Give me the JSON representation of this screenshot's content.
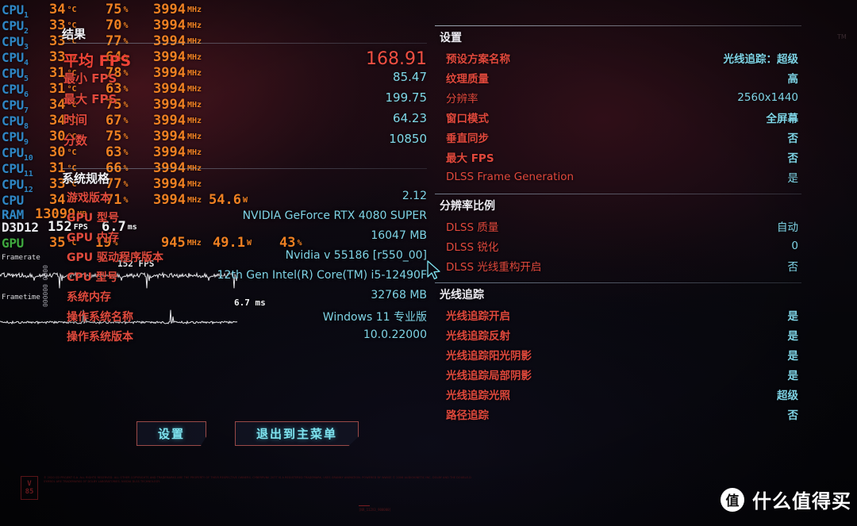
{
  "osd": {
    "units": {
      "temp": "°C",
      "pct": "%",
      "mhz": "MHz",
      "watt": "W",
      "mb": "MB",
      "fps": "FPS",
      "ms": "ms"
    },
    "rows": [
      {
        "name": "CPU",
        "sub": "1",
        "temp": "34",
        "use": "75",
        "clk": "3994"
      },
      {
        "name": "CPU",
        "sub": "2",
        "temp": "33",
        "use": "70",
        "clk": "3994"
      },
      {
        "name": "CPU",
        "sub": "3",
        "temp": "33",
        "use": "77",
        "clk": "3994"
      },
      {
        "name": "CPU",
        "sub": "4",
        "temp": "33",
        "use": "64",
        "clk": "3994"
      },
      {
        "name": "CPU",
        "sub": "5",
        "temp": "31",
        "use": "78",
        "clk": "3994"
      },
      {
        "name": "CPU",
        "sub": "6",
        "temp": "31",
        "use": "63",
        "clk": "3994"
      },
      {
        "name": "CPU",
        "sub": "7",
        "temp": "34",
        "use": "75",
        "clk": "3994"
      },
      {
        "name": "CPU",
        "sub": "8",
        "temp": "34",
        "use": "67",
        "clk": "3994"
      },
      {
        "name": "CPU",
        "sub": "9",
        "temp": "30",
        "use": "75",
        "clk": "3994"
      },
      {
        "name": "CPU",
        "sub": "10",
        "temp": "30",
        "use": "63",
        "clk": "3994"
      },
      {
        "name": "CPU",
        "sub": "11",
        "temp": "31",
        "use": "66",
        "clk": "3994"
      },
      {
        "name": "CPU",
        "sub": "12",
        "temp": "33",
        "use": "77",
        "clk": "3994"
      }
    ],
    "cpu_total": {
      "name": "CPU",
      "temp": "34",
      "use": "71",
      "clk": "3994",
      "power": "54.6"
    },
    "ram": {
      "name": "RAM",
      "value": "13099"
    },
    "d3d12": {
      "name": "D3D12",
      "fps": "152",
      "frametime": "6.7"
    },
    "gpu": {
      "name": "GPU",
      "temp": "35",
      "use": "19",
      "clk": "945",
      "power": "49.1",
      "mem": "43"
    },
    "framerate_label": "Framerate",
    "frametime_label": "Frametime",
    "framerate_side": "0000 000000",
    "graph_fps": "152 FPS",
    "graph_ms": "6.7 ms"
  },
  "benchmark": {
    "title": "结果",
    "rows": [
      {
        "label": "平均 FPS",
        "value": "168.91",
        "big": true
      },
      {
        "label": "最小 FPS",
        "value": "85.47",
        "big": false
      },
      {
        "label": "最大 FPS",
        "value": "199.75",
        "big": false
      },
      {
        "label": "时间",
        "value": "64.23",
        "big": false
      },
      {
        "label": "分数",
        "value": "10850",
        "big": false
      }
    ]
  },
  "spec": {
    "title": "系统规格",
    "rows": [
      {
        "label": "游戏版本",
        "value": "2.12"
      },
      {
        "label": "GPU 型号",
        "value": "NVIDIA GeForce RTX 4080 SUPER"
      },
      {
        "label": "GPU 内存",
        "value": "16047 MB"
      },
      {
        "label": "GPU 驱动程序版本",
        "value": "Nvidia v 55186 [r550_00]"
      },
      {
        "label": "CPU 型号",
        "value": "12th Gen Intel(R) Core(TM) i5-12490F"
      },
      {
        "label": "系统内存",
        "value": "32768 MB"
      },
      {
        "label": "操作系统名称",
        "value": "Windows 11 专业版"
      },
      {
        "label": "操作系统版本",
        "value": "10.0.22000"
      }
    ]
  },
  "settings": {
    "title": "设置",
    "rows": [
      {
        "label": "预设方案名称",
        "value": "光线追踪：超级",
        "latin": false
      },
      {
        "label": "纹理质量",
        "value": "高",
        "latin": false
      },
      {
        "label": "分辨率",
        "value": "2560x1440",
        "latin": true
      },
      {
        "label": "窗口模式",
        "value": "全屏幕",
        "latin": false
      },
      {
        "label": "垂直同步",
        "value": "否",
        "latin": false
      },
      {
        "label": "最大 FPS",
        "value": "否",
        "latin": false
      },
      {
        "label": "DLSS Frame Generation",
        "value": "是",
        "latin": true
      }
    ]
  },
  "resolution_scale": {
    "title": "分辨率比例",
    "rows": [
      {
        "label": "DLSS 质量",
        "value": "自动",
        "latin": true
      },
      {
        "label": "DLSS 锐化",
        "value": "0",
        "latin": true
      },
      {
        "label": "DLSS 光线重构开启",
        "value": "否",
        "latin": true
      }
    ]
  },
  "ray_tracing": {
    "title": "光线追踪",
    "rows": [
      {
        "label": "光线追踪开启",
        "value": "是",
        "latin": false
      },
      {
        "label": "光线追踪反射",
        "value": "是",
        "latin": false
      },
      {
        "label": "光线追踪阳光阴影",
        "value": "是",
        "latin": false
      },
      {
        "label": "光线追踪局部阴影",
        "value": "是",
        "latin": false
      },
      {
        "label": "光线追踪光照",
        "value": "超级",
        "latin": false
      },
      {
        "label": "路径追踪",
        "value": "否",
        "latin": false
      }
    ]
  },
  "buttons": {
    "settings": "设置",
    "exit_to_main_menu": "退出到主菜单"
  },
  "watermark": {
    "version_badge_top": "V",
    "version_badge_bottom": "85",
    "legal": "© 2020 CD PROJEKT S.A. ALL RIGHTS RESERVED. ALL OTHER COPYRIGHTS AND TRADEMARKS ARE THE PROPERTY OF THEIR RESPECTIVE OWNERS. CYBERPUNK 2077 IS A REGISTERED TRADEMARK. USES GRANNY ANIMATION. POWERED BY WWISE © 2006 AUDIOKINETIC INC. DOLBY AND THE DOUBLE-D SYMBOL ARE TRADEMARKS OF DOLBY LABORATORIES. NVIDIA DLSS TECHNOLOGY.",
    "small_tag": "[NR_112X3_900000]",
    "brand_mark": "值",
    "brand_text": "什么值得买",
    "corner": "TM"
  },
  "colors": {
    "accent_cyan": "#7fd4e6",
    "accent_red": "#e0483c",
    "osd_orange": "#ef8022",
    "osd_blue": "#2f86c4"
  }
}
